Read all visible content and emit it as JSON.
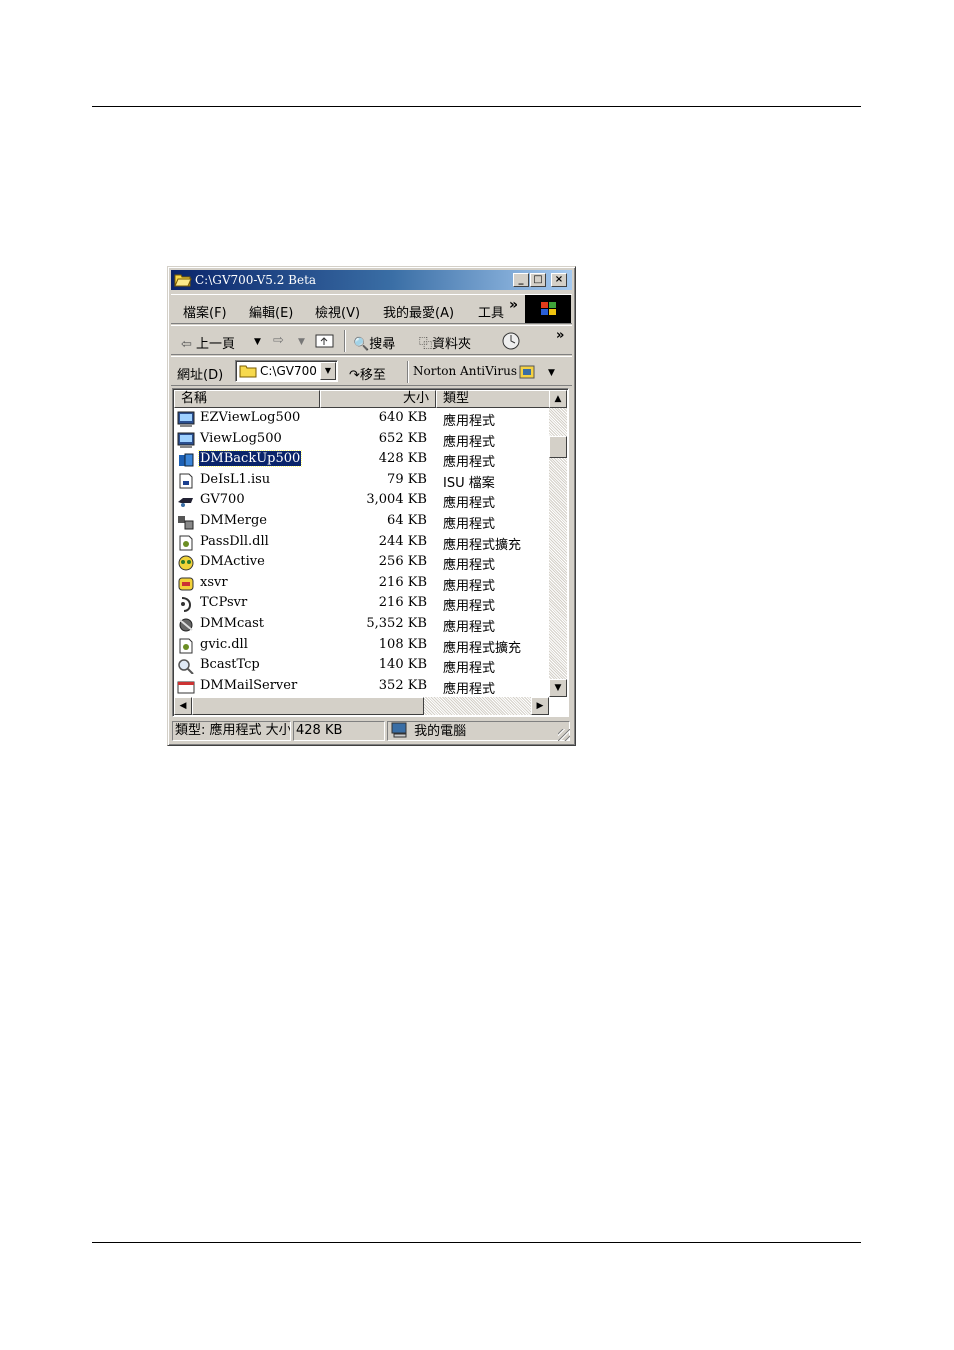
{
  "window": {
    "title": "C:\\GV700-V5.2 Beta",
    "caption_buttons": {
      "minimize": "_",
      "maximize": "□",
      "close": "×"
    }
  },
  "menu": {
    "items": [
      "檔案(F)",
      "編輯(E)",
      "檢視(V)",
      "我的最愛(A)",
      "工具"
    ],
    "overflow": "»"
  },
  "toolbar": {
    "back": "上一頁",
    "search": "搜尋",
    "folders": "資料夾",
    "overflow": "»"
  },
  "address": {
    "label": "網址(D)",
    "value": "C:\\GV700",
    "go": "移至",
    "norton": "Norton AntiVirus"
  },
  "list": {
    "columns": {
      "name": "名稱",
      "size": "大小",
      "type": "類型"
    },
    "rows": [
      {
        "name": "EZViewLog500",
        "size": "640 KB",
        "type": "應用程式",
        "icon": "app-monitor-icon"
      },
      {
        "name": "ViewLog500",
        "size": "652 KB",
        "type": "應用程式",
        "icon": "app-monitor-icon"
      },
      {
        "name": "DMBackUp500",
        "size": "428 KB",
        "type": "應用程式",
        "icon": "backup-icon",
        "selected": true
      },
      {
        "name": "DeIsL1.isu",
        "size": "79 KB",
        "type": "ISU 檔案",
        "icon": "isu-file-icon"
      },
      {
        "name": "GV700",
        "size": "3,004 KB",
        "type": "應用程式",
        "icon": "camera-icon"
      },
      {
        "name": "DMMerge",
        "size": "64 KB",
        "type": "應用程式",
        "icon": "merge-icon"
      },
      {
        "name": "PassDll.dll",
        "size": "244 KB",
        "type": "應用程式擴充",
        "icon": "dll-icon"
      },
      {
        "name": "DMActive",
        "size": "256 KB",
        "type": "應用程式",
        "icon": "active-icon"
      },
      {
        "name": "xsvr",
        "size": "216 KB",
        "type": "應用程式",
        "icon": "server-icon"
      },
      {
        "name": "TCPsvr",
        "size": "216 KB",
        "type": "應用程式",
        "icon": "tcp-icon"
      },
      {
        "name": "DMMcast",
        "size": "5,352 KB",
        "type": "應用程式",
        "icon": "mcast-icon"
      },
      {
        "name": "gvic.dll",
        "size": "108 KB",
        "type": "應用程式擴充",
        "icon": "dll-icon"
      },
      {
        "name": "BcastTcp",
        "size": "140 KB",
        "type": "應用程式",
        "icon": "magnifier-icon"
      },
      {
        "name": "DMMailServer",
        "size": "352 KB",
        "type": "應用程式",
        "icon": "mail-icon"
      }
    ]
  },
  "status": {
    "type_text": "類型: 應用程式 大小",
    "size_text": "428 KB",
    "zone_text": "我的電腦"
  },
  "colors": {
    "titlebar_start": "#0a246a",
    "titlebar_end": "#a6caf0",
    "face": "#d4d0c8",
    "selection": "#0a246a"
  }
}
